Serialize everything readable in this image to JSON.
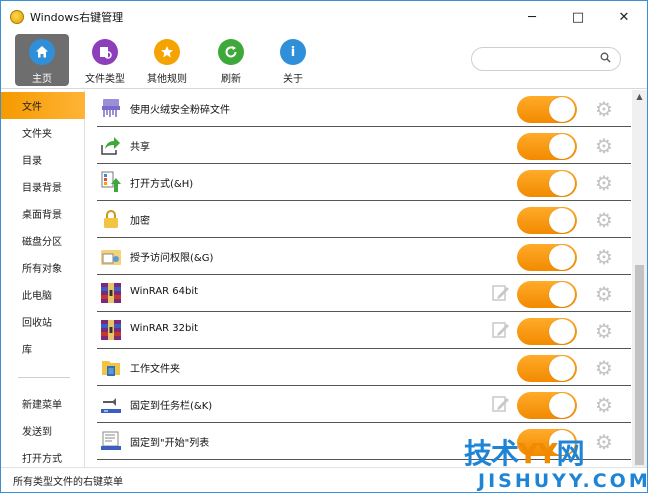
{
  "window": {
    "title": "Windows右键管理",
    "minimize": "─",
    "maximize": "□",
    "close": "✕"
  },
  "toolbar": {
    "items": [
      {
        "label": "主页",
        "icon": "home-icon",
        "color": "#2f8fd8"
      },
      {
        "label": "文件类型",
        "icon": "file-types-icon",
        "color": "#8c3fb8"
      },
      {
        "label": "其他规则",
        "icon": "star-icon",
        "color": "#f5a300"
      },
      {
        "label": "刷新",
        "icon": "refresh-icon",
        "color": "#3ea83b"
      },
      {
        "label": "关于",
        "icon": "info-icon",
        "color": "#2f8fd8"
      }
    ],
    "search_placeholder": ""
  },
  "sidebar": {
    "items": [
      {
        "label": "文件"
      },
      {
        "label": "文件夹"
      },
      {
        "label": "目录"
      },
      {
        "label": "目录背景"
      },
      {
        "label": "桌面背景"
      },
      {
        "label": "磁盘分区"
      },
      {
        "label": "所有对象"
      },
      {
        "label": "此电脑"
      },
      {
        "label": "回收站"
      },
      {
        "label": "库"
      },
      {
        "label": "新建菜单"
      },
      {
        "label": "发送到"
      },
      {
        "label": "打开方式"
      }
    ]
  },
  "rows": [
    {
      "label": "使用火绒安全粉碎文件",
      "icon": "shredder-icon",
      "enabled": true,
      "has_edit": false
    },
    {
      "label": "共享",
      "icon": "share-icon",
      "enabled": true,
      "has_edit": false
    },
    {
      "label": "打开方式(&H)",
      "icon": "open-with-icon",
      "enabled": true,
      "has_edit": false
    },
    {
      "label": "加密",
      "icon": "lock-icon",
      "enabled": true,
      "has_edit": false
    },
    {
      "label": "授予访问权限(&G)",
      "icon": "permissions-icon",
      "enabled": true,
      "has_edit": false
    },
    {
      "label": "WinRAR 64bit",
      "icon": "winrar-icon",
      "enabled": true,
      "has_edit": true
    },
    {
      "label": "WinRAR 32bit",
      "icon": "winrar-icon",
      "enabled": true,
      "has_edit": true
    },
    {
      "label": "工作文件夹",
      "icon": "work-folders-icon",
      "enabled": true,
      "has_edit": false
    },
    {
      "label": "固定到任务栏(&K)",
      "icon": "pin-taskbar-icon",
      "enabled": true,
      "has_edit": true
    },
    {
      "label": "固定到\"开始\"列表",
      "icon": "pin-start-icon",
      "enabled": true,
      "has_edit": false
    }
  ],
  "statusbar": {
    "text": "所有类型文件的右键菜单"
  },
  "watermark": {
    "top_left": "技术",
    "top_yy": "YY",
    "top_right": "网",
    "bottom": "JISHUYY.COM"
  },
  "colors": {
    "accent": "#f59a00",
    "toggle_on": "#f28a00",
    "watermark_blue": "#1d84d6"
  }
}
